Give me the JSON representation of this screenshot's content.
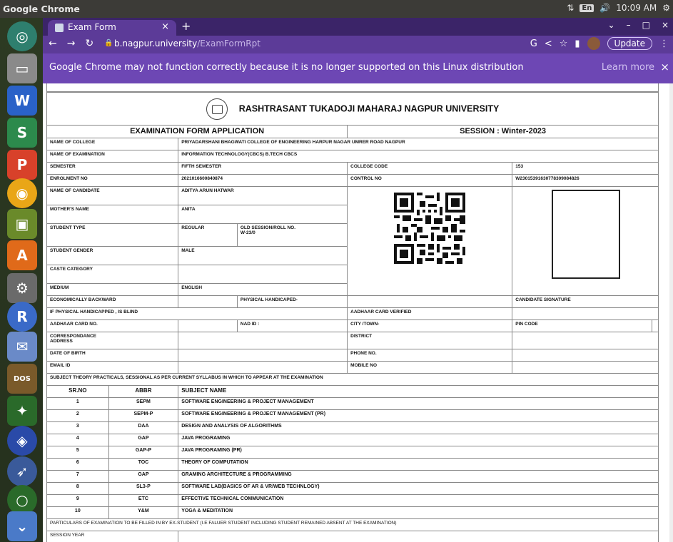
{
  "system": {
    "app_name": "Google Chrome",
    "time": "10:09 AM",
    "keyboard": "En"
  },
  "browser": {
    "tab_title": "Exam Form",
    "url_domain": "b.nagpur.university",
    "url_path": "/ExamFormRpt",
    "update_label": "Update",
    "infobar_message": "Google Chrome may not function correctly because it is no longer supported on this Linux distribution",
    "learn_more": "Learn more"
  },
  "form": {
    "university": "RASHTRASANT TUKADOJI MAHARAJ NAGPUR UNIVERSITY",
    "heading": "EXAMINATION FORM APPLICATION",
    "session": "SESSION : Winter-2023",
    "labels": {
      "college": "NAME OF COLLEGE",
      "exam": "NAME OF EXAMINATION",
      "semester": "SEMESTER",
      "college_code": "COLLEGE CODE",
      "enrolment": "ENROLMENT NO",
      "control": "CONTROL NO",
      "candidate": "NAME OF CANDIDATE",
      "mother": "MOTHER'S NAME",
      "student_type": "STUDENT TYPE",
      "old_session": "OLD SESSION/ROLL NO.",
      "gender": "STUDENT GENDER",
      "caste": "CASTE CATEGORY",
      "medium": "MEDIUM",
      "eco_backward": "ECONOMICALLY BACKWARD",
      "physical_handicaped": "PHYSICAL HANDICAPED-",
      "candidate_signature": "CANDIDATE SIGNATURE",
      "if_handicapped": "IF PHYSICAL HANDICAPPED , IS BLIND",
      "aadhaar_verified": "AADHAAR CARD VERIFIED",
      "aadhaar_no": "AADHAAR CARD NO.",
      "nad_id": "NAD ID :",
      "city": "CITY /TOWN-",
      "pin": "PIN CODE",
      "corr_address_1": "CORRESPONDANCE",
      "corr_address_2": "ADDRESS",
      "district": "DISTRICT",
      "dob": "DATE OF BIRTH",
      "phone": "PHONE NO.",
      "email": "EMAIL ID",
      "mobile": "MOBILE NO"
    },
    "values": {
      "college": "PRIYADARSHANI BHAGWATI COLLEGE OF ENGINEERING HARPUR NAGAR UMRER ROAD NAGPUR",
      "exam": "INFORMATION TECHNOLOGY(CBCS) B.TECH CBCS",
      "semester": "FIFTH SEMESTER",
      "college_code": "153",
      "enrolment": "2021016600840874",
      "control": "W230153916307783090848​26",
      "candidate": "ADITYA ARUN HATWAR",
      "mother": "ANITA",
      "student_type": "REGULAR",
      "old_session": "W-23/0",
      "gender": "MALE",
      "medium": "ENGLISH"
    },
    "subjects_caption": "SUBJECT THEORY PRACTICALS, SESSIONAL AS PER CURRENT SYLLABUS IN WHICH TO APPEAR AT THE EXAMINATION",
    "subject_headers": {
      "sr": "SR.NO",
      "abbr": "ABBR",
      "name": "SUBJECT NAME"
    },
    "subjects": [
      {
        "sr": "1",
        "abbr": "SEPM",
        "name": "SOFTWARE ENGINEERING & PROJECT MANAGEMENT"
      },
      {
        "sr": "2",
        "abbr": "SEPM-P",
        "name": "SOFTWARE ENGINEERING & PROJECT MANAGEMENT (PR)"
      },
      {
        "sr": "3",
        "abbr": "DAA",
        "name": "DESIGN AND ANALYSIS OF ALGORITHMS"
      },
      {
        "sr": "4",
        "abbr": "GAP",
        "name": "JAVA PROGRAMING"
      },
      {
        "sr": "5",
        "abbr": "GAP-P",
        "name": "JAVA PROGRAMING (PR)"
      },
      {
        "sr": "6",
        "abbr": "TOC",
        "name": "THEORY OF COMPUTATION"
      },
      {
        "sr": "7",
        "abbr": "GAP",
        "name": "GRAMING ARCHITECTURE & PROGRAMMING"
      },
      {
        "sr": "8",
        "abbr": "SL3-P",
        "name": "SOFTWARE LAB(BASICS OF AR & VR/WEB TECHNLOGY)"
      },
      {
        "sr": "9",
        "abbr": "ETC",
        "name": "EFFECTIVE TECHNICAL COMMUNICATION"
      },
      {
        "sr": "10",
        "abbr": "Y&M",
        "name": "YOGA & MEDITATION"
      }
    ],
    "ex_student_caption": "PARTICULARS OF EXAMINATION TO BE FILLED IN BY EX-STUDENT (I.E FALUER STUDENT INCLUDING STUDENT REMAINED ABSENT AT THE EXAMINATION)",
    "session_year": "SESSION YEAR"
  }
}
